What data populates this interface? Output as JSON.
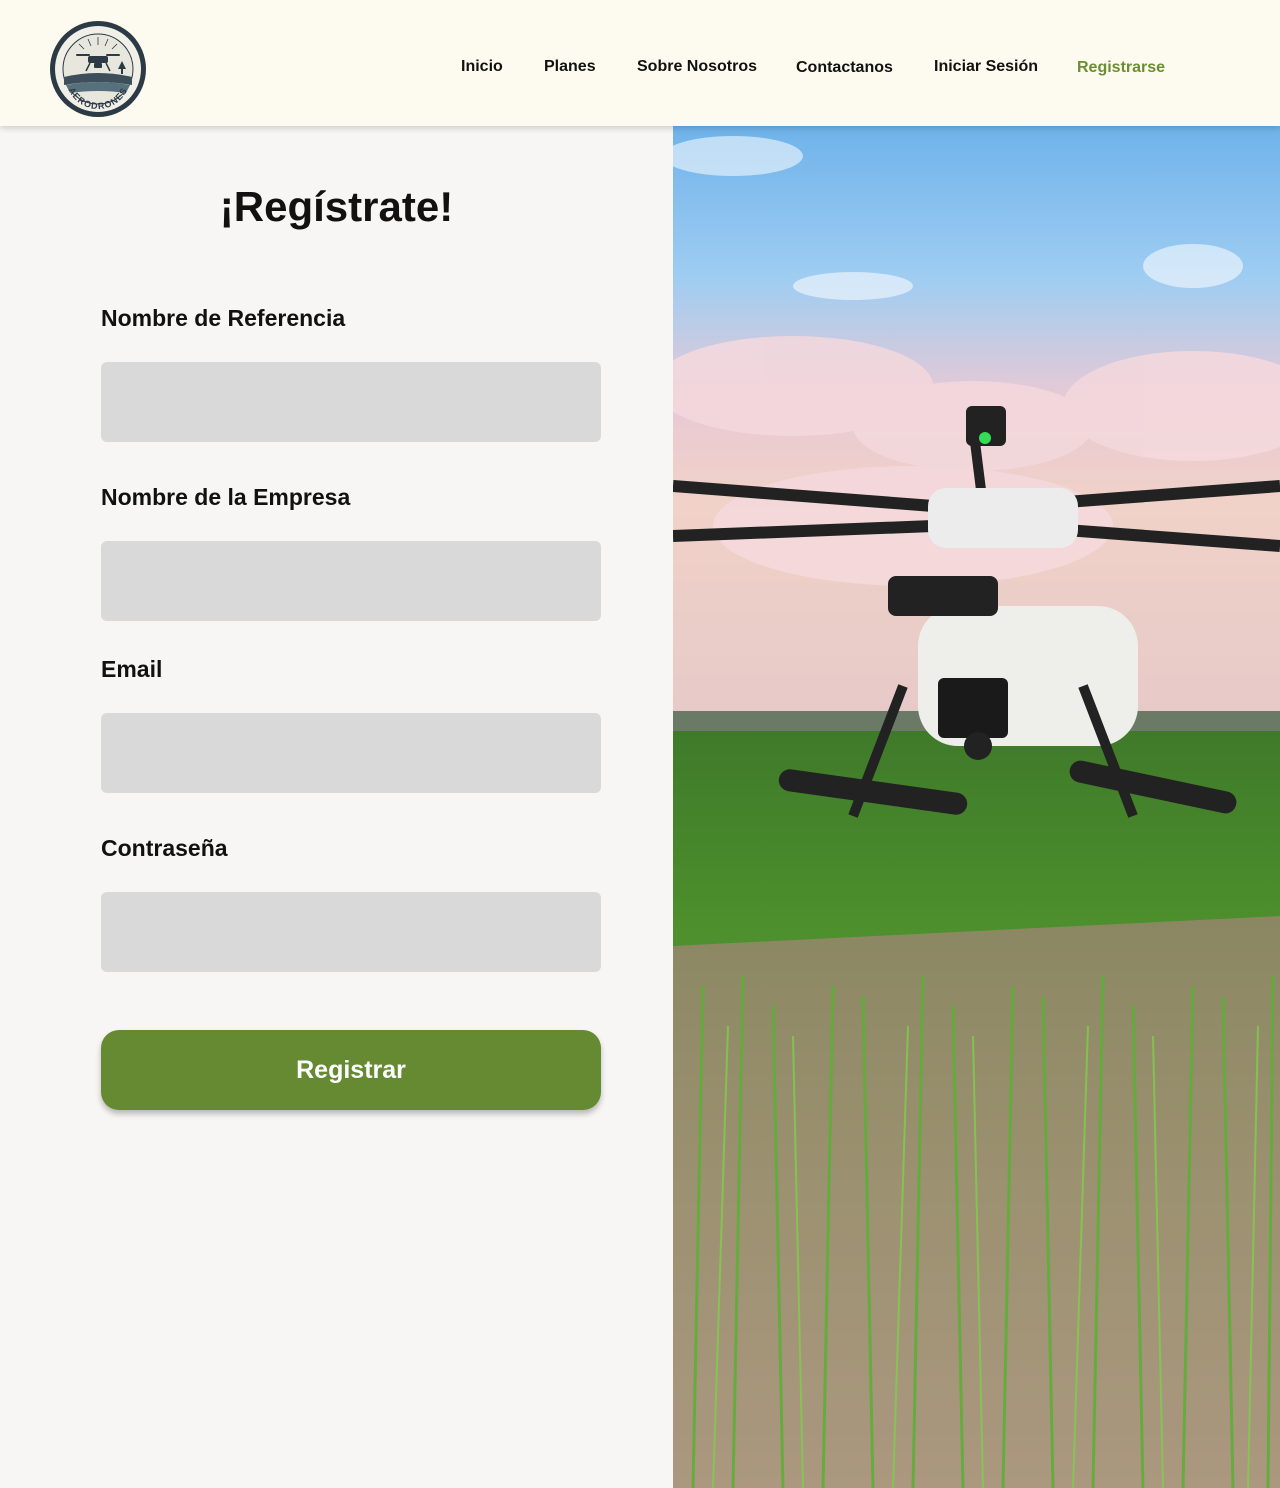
{
  "brand": {
    "logo_text": "AERODRONES"
  },
  "nav": {
    "items": [
      {
        "label": "Inicio"
      },
      {
        "label": "Planes"
      },
      {
        "label": "Sobre Nosotros"
      },
      {
        "label": "Contactanos"
      },
      {
        "label": "Iniciar Sesión"
      },
      {
        "label": "Registrarse",
        "active": true
      }
    ]
  },
  "form": {
    "title": "¡Regístrate!",
    "fields": [
      {
        "label": "Nombre de Referencia",
        "value": ""
      },
      {
        "label": "Nombre de la Empresa",
        "value": ""
      },
      {
        "label": "Email",
        "value": ""
      },
      {
        "label": "Contraseña",
        "value": ""
      }
    ],
    "submit_label": "Registrar"
  },
  "colors": {
    "accent": "#668a32",
    "nav_active": "#6a8f33",
    "header_bg": "#fdfbf0",
    "input_bg": "#d9d9d9"
  },
  "icons": {
    "logo": "drone-badge-icon"
  }
}
